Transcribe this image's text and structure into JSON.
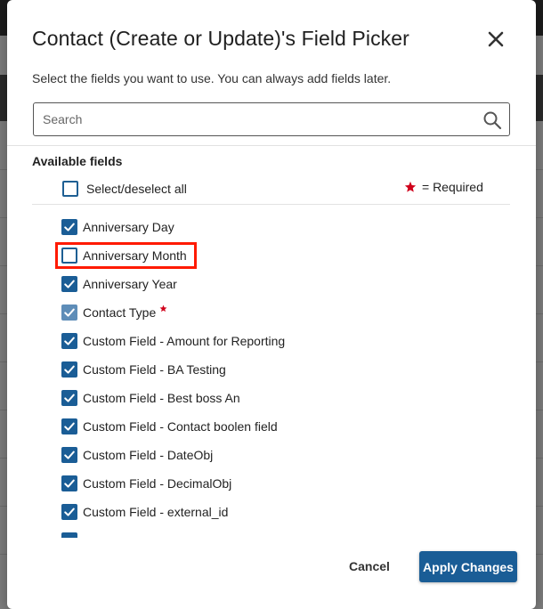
{
  "dialog": {
    "title": "Contact (Create or Update)'s Field Picker",
    "subtitle": "Select the fields you want to use. You can always add fields later.",
    "search": {
      "placeholder": "Search",
      "value": ""
    },
    "section_label": "Available fields",
    "select_all_label": "Select/deselect all",
    "legend_text": "= Required",
    "fields": [
      {
        "label": "Anniversary Day",
        "checked": true,
        "required": false
      },
      {
        "label": "Anniversary Month",
        "checked": false,
        "required": false
      },
      {
        "label": "Anniversary Year",
        "checked": true,
        "required": false
      },
      {
        "label": "Contact Type",
        "checked": true,
        "required": true
      },
      {
        "label": "Custom Field - Amount for Reporting",
        "checked": true,
        "required": false
      },
      {
        "label": "Custom Field - BA Testing",
        "checked": true,
        "required": false
      },
      {
        "label": "Custom Field - Best boss An",
        "checked": true,
        "required": false
      },
      {
        "label": "Custom Field - Contact boolen field",
        "checked": true,
        "required": false
      },
      {
        "label": "Custom Field - DateObj",
        "checked": true,
        "required": false
      },
      {
        "label": "Custom Field - DecimalObj",
        "checked": true,
        "required": false
      },
      {
        "label": "Custom Field - external_id",
        "checked": true,
        "required": false
      }
    ],
    "cancel_label": "Cancel",
    "apply_label": "Apply Changes"
  },
  "colors": {
    "primary": "#1a5d96",
    "required_star": "#d0021b",
    "highlight": "#ff1a00"
  }
}
